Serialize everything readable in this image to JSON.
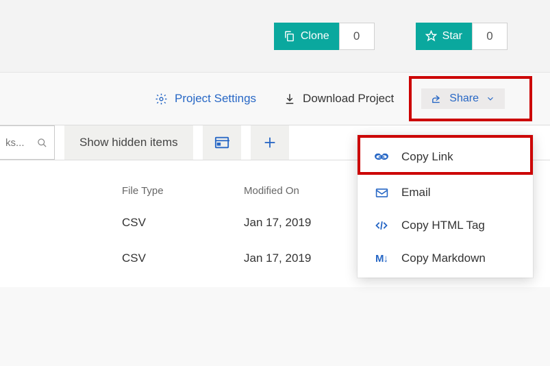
{
  "topbar": {
    "clone": {
      "label": "Clone",
      "count": "0"
    },
    "star": {
      "label": "Star",
      "count": "0"
    }
  },
  "actions": {
    "settings": "Project Settings",
    "download": "Download Project",
    "share": "Share"
  },
  "toolbar": {
    "search_placeholder": "ks...",
    "show_hidden": "Show hidden items"
  },
  "table": {
    "headers": {
      "type": "File Type",
      "modified": "Modified On"
    },
    "rows": [
      {
        "type": "CSV",
        "modified": "Jan 17, 2019"
      },
      {
        "type": "CSV",
        "modified": "Jan 17, 2019"
      }
    ]
  },
  "share_menu": {
    "items": [
      {
        "label": "Copy Link"
      },
      {
        "label": "Email"
      },
      {
        "label": "Copy HTML Tag"
      },
      {
        "label": "Copy Markdown"
      }
    ]
  }
}
